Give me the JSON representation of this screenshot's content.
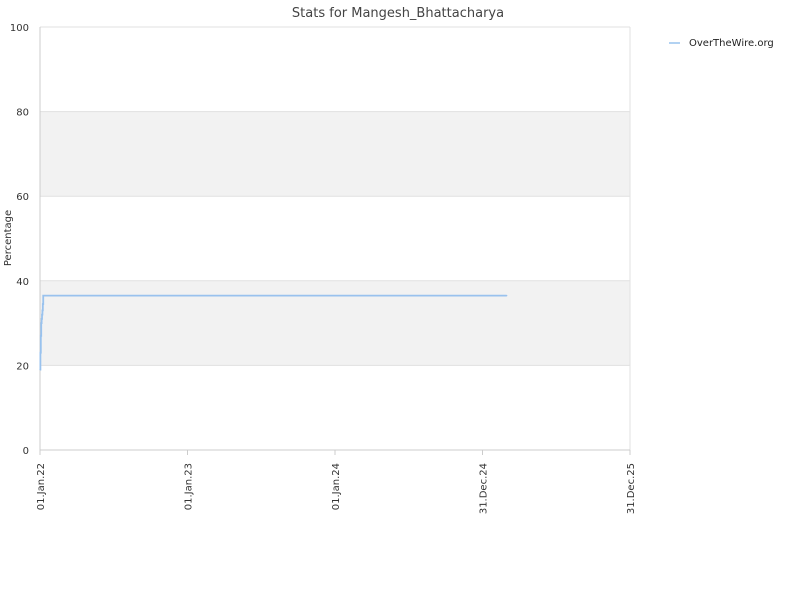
{
  "chart_data": {
    "type": "line",
    "title": "Stats for Mangesh_Bhattacharya",
    "xlabel": "",
    "ylabel": "Percentage",
    "x_ticks": [
      "01.Jan.22",
      "01.Jan.23",
      "01.Jan.24",
      "31.Dec.24",
      "31.Dec.25"
    ],
    "xlim": [
      "2022-01-01",
      "2025-12-31"
    ],
    "ylim": [
      0,
      100
    ],
    "y_ticks": [
      0,
      20,
      40,
      60,
      80,
      100
    ],
    "grid": true,
    "alternating_bands": true,
    "legend_position": "top-right",
    "series": [
      {
        "name": "OverTheWire.org",
        "color": "#99c2ee",
        "step": true,
        "points": [
          {
            "x": "2022-01-01",
            "y": 19
          },
          {
            "x": "2022-01-02",
            "y": 21
          },
          {
            "x": "2022-01-02",
            "y": 23
          },
          {
            "x": "2022-01-03",
            "y": 25
          },
          {
            "x": "2022-01-03",
            "y": 27
          },
          {
            "x": "2022-01-04",
            "y": 29
          },
          {
            "x": "2022-01-04",
            "y": 30
          },
          {
            "x": "2022-01-05",
            "y": 31
          },
          {
            "x": "2022-01-06",
            "y": 32
          },
          {
            "x": "2022-01-07",
            "y": 33
          },
          {
            "x": "2022-01-08",
            "y": 34.5
          },
          {
            "x": "2022-01-09",
            "y": 36.5
          },
          {
            "x": "2025-03-01",
            "y": 36.5
          }
        ]
      }
    ]
  }
}
